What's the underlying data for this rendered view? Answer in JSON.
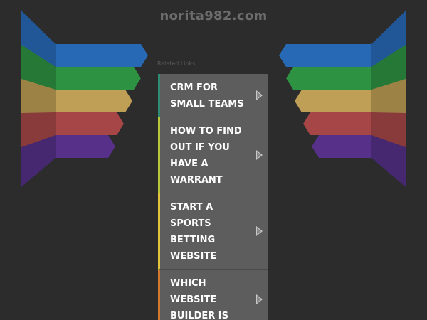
{
  "header": {
    "domain": "norita982.com",
    "related_links_label": "Related Links"
  },
  "links": [
    {
      "label": "CRM FOR SMALL TEAMS",
      "accent": "#2e8b74"
    },
    {
      "label": "HOW TO FIND OUT IF YOU HAVE A WARRANT",
      "accent": "#b8c83a"
    },
    {
      "label": "START A SPORTS BETTING WEBSITE",
      "accent": "#e2c53a"
    },
    {
      "label": "WHICH WEBSITE BUILDER IS",
      "accent": "#d4782e"
    }
  ],
  "decor": {
    "stripe_colors": [
      "#2a6fc0",
      "#2f9a45",
      "#c9a75a",
      "#b04a4a",
      "#5a3390"
    ]
  }
}
